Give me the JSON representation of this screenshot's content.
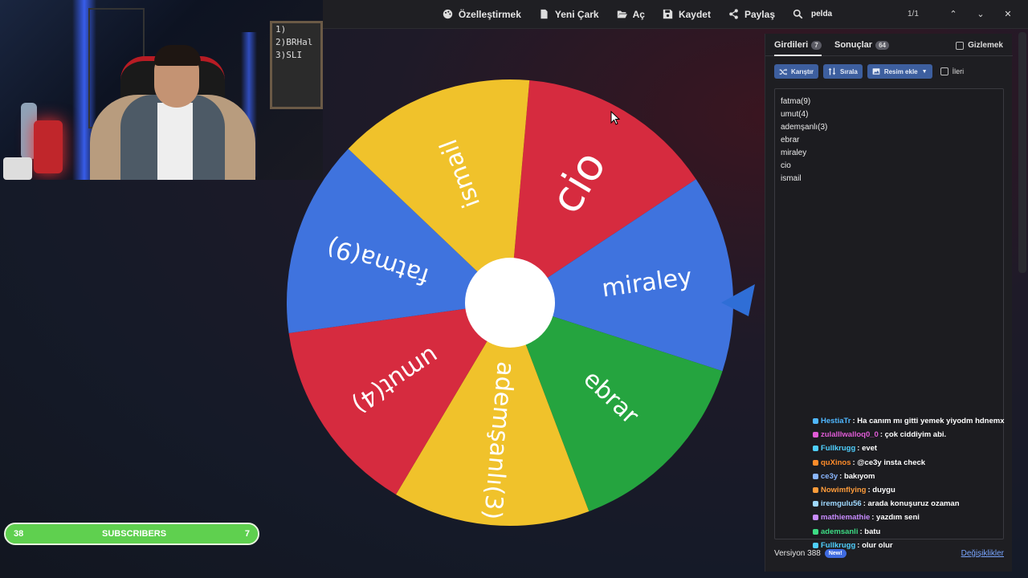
{
  "toolbar": {
    "customize": "Özelleştirmek",
    "new_wheel": "Yeni Çark",
    "open": "Aç",
    "save": "Kaydet",
    "share": "Paylaş",
    "search_value": "pelda",
    "search_count": "1/1"
  },
  "webcam": {
    "board_lines": [
      "1)",
      "2)BRHal",
      "3)SLI"
    ]
  },
  "wheel": {
    "segments": [
      {
        "label": "cio",
        "color": "#d62b3f"
      },
      {
        "label": "miraley",
        "color": "#3f73de"
      },
      {
        "label": "ebrar",
        "color": "#25a43f"
      },
      {
        "label": "ademşanlı(3)",
        "color": "#f0c22b"
      },
      {
        "label": "umut(4)",
        "color": "#d62b3f"
      },
      {
        "label": "fatma(9)",
        "color": "#3f73de"
      },
      {
        "label": "ismail",
        "color": "#f0c22b"
      }
    ],
    "pointer_color": "#2f6ed6"
  },
  "subscribers": {
    "current": "38",
    "label": "SUBSCRIBERS",
    "goal": "7",
    "fill_fraction": 1.0
  },
  "panel": {
    "tab_entries": "Girdileri",
    "tab_entries_count": "7",
    "tab_results": "Sonuçlar",
    "tab_results_count": "64",
    "hide_label": "Gizlemek",
    "btn_shuffle": "Karıştır",
    "btn_sort": "Sırala",
    "btn_add_image": "Resim ekle",
    "advanced_label": "İleri",
    "entries": [
      "fatma(9)",
      "umut(4)",
      "ademşanlı(3)",
      "ebrar",
      "miraley",
      "cio",
      "ismail"
    ],
    "version": "Versiyon 388",
    "new_badge": "New!",
    "changes_link": "Değişiklikler"
  },
  "chat": [
    {
      "user": "HestiaTr",
      "msg": ": Ha canım mı gitti yemek yiyodm hdnemx",
      "color": "#4fb7ff"
    },
    {
      "user": "zulalllwalloq0_0",
      "msg": ": çok ciddiyim abi.",
      "color": "#e05bd6"
    },
    {
      "user": "Fullkrugg",
      "msg": ": evet",
      "color": "#4fd0ff"
    },
    {
      "user": "quXinos",
      "msg": ": @ce3y insta check",
      "color": "#ff8c2a"
    },
    {
      "user": "ce3y",
      "msg": ": bakıyom",
      "color": "#8ab6ff"
    },
    {
      "user": "Nowimflying",
      "msg": ": duygu",
      "color": "#ff9c3a"
    },
    {
      "user": "iremgulu56",
      "msg": ": arada konuşuruz ozaman",
      "color": "#9fd8ff"
    },
    {
      "user": "mathiemathie",
      "msg": ": yazdım seni",
      "color": "#c88cff"
    },
    {
      "user": "ademsanli",
      "msg": ": batu",
      "color": "#3ddc84"
    },
    {
      "user": "Fullkrugg",
      "msg": ": olur olur",
      "color": "#4fd0ff"
    }
  ]
}
